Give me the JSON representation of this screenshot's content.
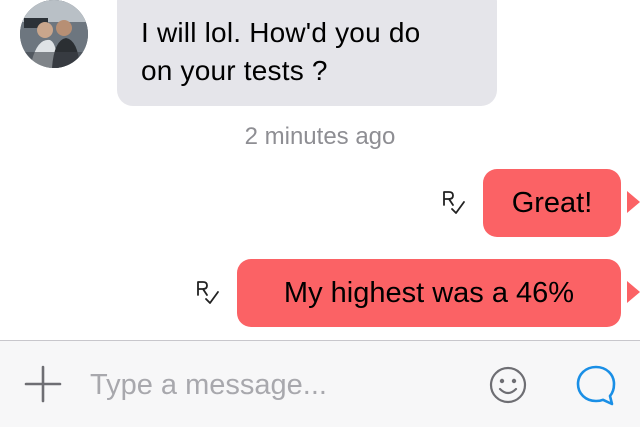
{
  "conversation": {
    "messages": [
      {
        "direction": "incoming",
        "lines": [
          "I will lol. How'd you do",
          "on your tests ?"
        ]
      },
      {
        "direction": "outgoing",
        "text": "Great!",
        "receipt": "read"
      },
      {
        "direction": "outgoing",
        "text": "My highest was a 46%",
        "receipt": "read"
      }
    ],
    "timestamp": "2 minutes ago"
  },
  "composer": {
    "placeholder": "Type a message...",
    "value": ""
  },
  "icons": {
    "add": "plus-icon",
    "emoji": "smiley-icon",
    "send": "chat-bubble-icon",
    "receipt": "read-receipt-icon"
  },
  "colors": {
    "outgoing_bubble": "#fb6265",
    "incoming_bubble": "#e5e5ea",
    "accent": "#1a8fe6",
    "timestamp": "#8e8e93"
  }
}
